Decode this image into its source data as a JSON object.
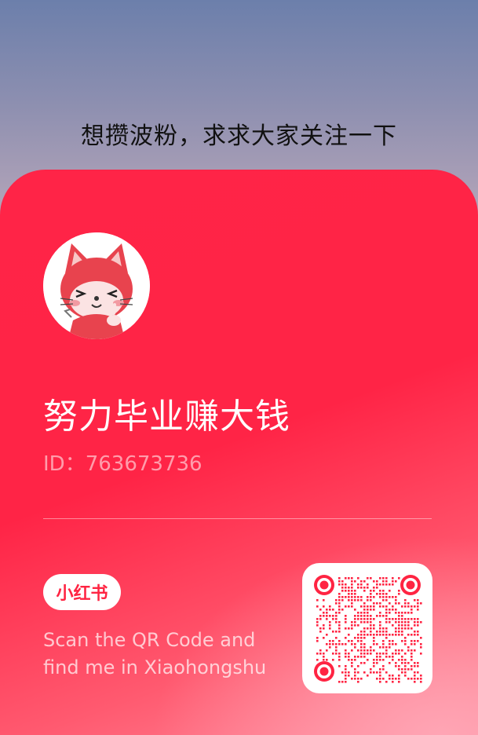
{
  "caption": "想攒波粉，求求大家关注一下",
  "profile": {
    "username": "努力毕业赚大钱",
    "id_text": "ID：763673736"
  },
  "footer": {
    "brand": "小红书",
    "scan_line1": "Scan the QR Code and",
    "scan_line2": "find me in Xiaohongshu"
  },
  "colors": {
    "accent": "#ff2442",
    "card_top": "#ff2447",
    "card_bottom": "#ff8c9c"
  }
}
